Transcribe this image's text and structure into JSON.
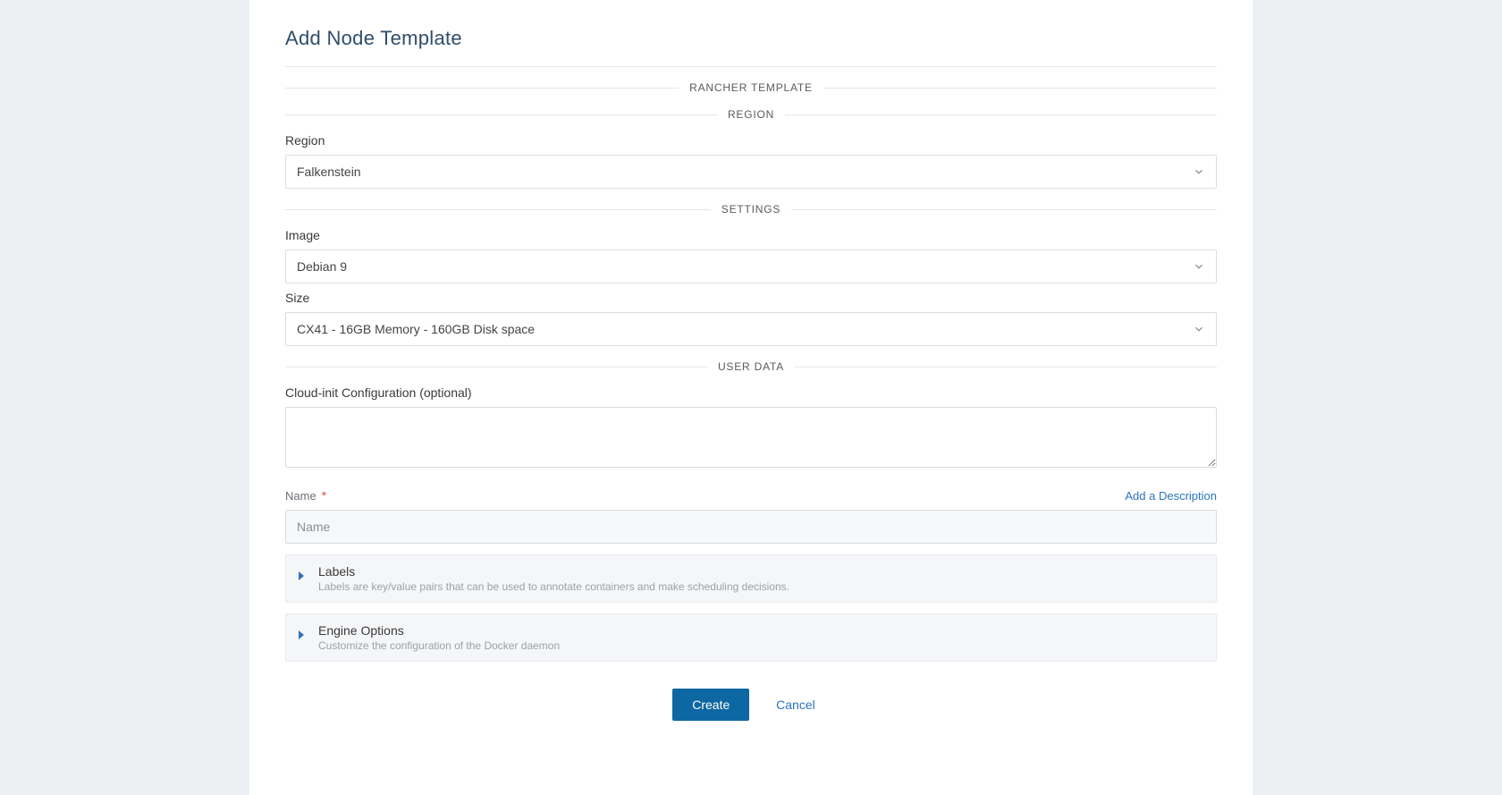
{
  "modal": {
    "title": "Add Node Template",
    "section_rancher_template": "RANCHER TEMPLATE",
    "section_region": "REGION",
    "section_settings": "SETTINGS",
    "section_user_data": "USER DATA"
  },
  "region": {
    "label": "Region",
    "selected": "Falkenstein"
  },
  "image": {
    "label": "Image",
    "selected": "Debian 9"
  },
  "size": {
    "label": "Size",
    "selected": "CX41 - 16GB Memory - 160GB Disk space"
  },
  "cloud_init": {
    "label": "Cloud-init Configuration (optional)",
    "value": ""
  },
  "name_field": {
    "label": "Name",
    "required_marker": "*",
    "placeholder": "Name",
    "value": "",
    "add_description": "Add a Description"
  },
  "labels_panel": {
    "title": "Labels",
    "description": "Labels are key/value pairs that can be used to annotate containers and make scheduling decisions."
  },
  "engine_panel": {
    "title": "Engine Options",
    "description": "Customize the configuration of the Docker daemon"
  },
  "footer": {
    "create": "Create",
    "cancel": "Cancel"
  }
}
